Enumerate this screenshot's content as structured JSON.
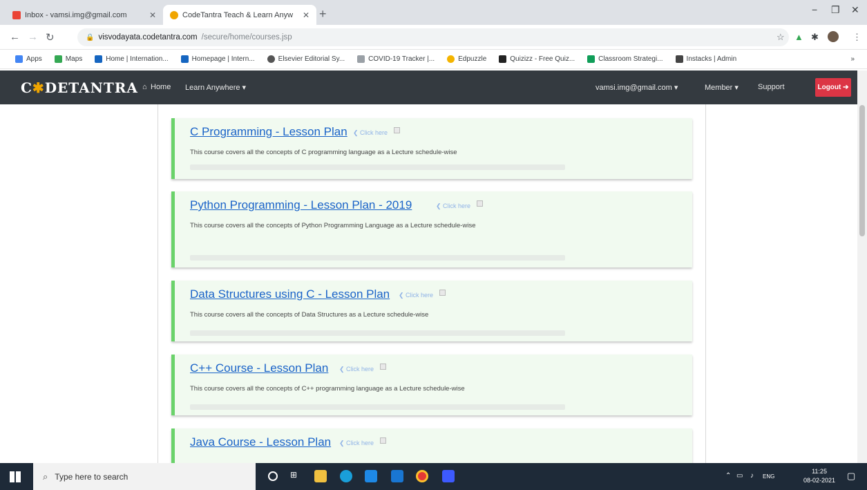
{
  "browser": {
    "tabs": [
      {
        "title": "Inbox - vamsi.img@gmail.com",
        "active": false
      },
      {
        "title": "CodeTantra Teach & Learn Anyw",
        "active": true
      }
    ],
    "new_tab": "+",
    "minimize": "−",
    "maximize": "❐",
    "close": "✕",
    "url_host": "visvodayata.codetantra.com",
    "url_path": "/secure/home/courses.jsp",
    "bookmarks": [
      "Apps",
      "Maps",
      "Home | Internation...",
      "Homepage | Intern...",
      "Elsevier Editorial Sy...",
      "COVID-19 Tracker |...",
      "Edpuzzle",
      "Quizizz - Free Quiz...",
      "Classroom Strategi...",
      "Instacks | Admin"
    ],
    "bookmarks_more": "»"
  },
  "app": {
    "logo_prefix": "C",
    "logo_star": "✱",
    "logo_suffix": "DETANTRA",
    "nav_home": "Home",
    "nav_learn": "Learn Anywhere ▾",
    "user_email": "vamsi.img@gmail.com ▾",
    "member": "Member ▾",
    "support": "Support",
    "logout": "Logout ➔"
  },
  "courses": [
    {
      "title": "C Programming - Lesson Plan",
      "hint": "❮ Click here",
      "desc": "This course covers all the concepts of C programming language as a Lecture schedule-wise"
    },
    {
      "title": "Python Programming - Lesson Plan - 2019",
      "hint": "❮ Click here",
      "desc": "This course covers all the concepts of Python Programming Language as a Lecture schedule-wise"
    },
    {
      "title": "Data Structures using C - Lesson Plan",
      "hint": "❮ Click here",
      "desc": "This course covers all the concepts of Data Structures as a Lecture schedule-wise"
    },
    {
      "title": "C++ Course - Lesson Plan",
      "hint": "❮ Click here",
      "desc": "This course covers all the concepts of C++ programming language as a Lecture schedule-wise"
    },
    {
      "title": "Java Course - Lesson Plan",
      "hint": "❮ Click here",
      "desc": ""
    }
  ],
  "taskbar": {
    "search_placeholder": "Type here to search",
    "lang": "ENG",
    "time": "11:25",
    "date": "08-02-2021"
  },
  "colors": {
    "accent": "#6ad26a",
    "nav": "#343a40",
    "logout": "#dc3545",
    "link": "#1a63c8"
  }
}
